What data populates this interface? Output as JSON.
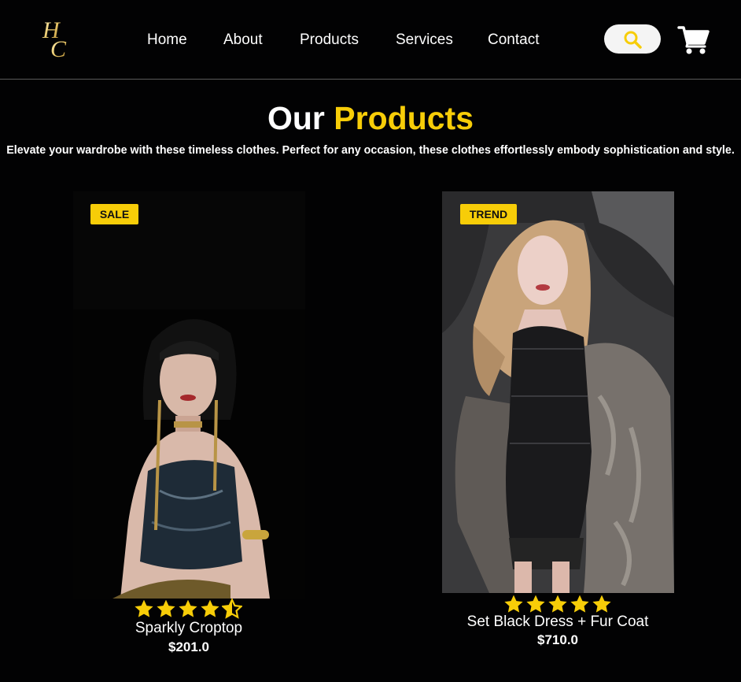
{
  "header": {
    "logo": {
      "text": "HC",
      "name": "hc-logo"
    },
    "nav": [
      "Home",
      "About",
      "Products",
      "Services",
      "Contact"
    ],
    "search_icon": "search-icon",
    "cart_icon": "cart-icon"
  },
  "main": {
    "title_part1": "Our",
    "title_part2": "Products",
    "subtitle": "Elevate your wardrobe with these timeless clothes. Perfect for any occasion, these clothes effortlessly embody sophistication and style."
  },
  "products": [
    {
      "badge": "SALE",
      "name": "Sparkly Croptop",
      "price": "$201.0",
      "rating": 4.5
    },
    {
      "badge": "TREND",
      "name": "Set Black Dress + Fur Coat",
      "price": "$710.0",
      "rating": 5
    }
  ],
  "colors": {
    "accent": "#f7cd08",
    "background": "#020203",
    "text": "#ffffff"
  }
}
